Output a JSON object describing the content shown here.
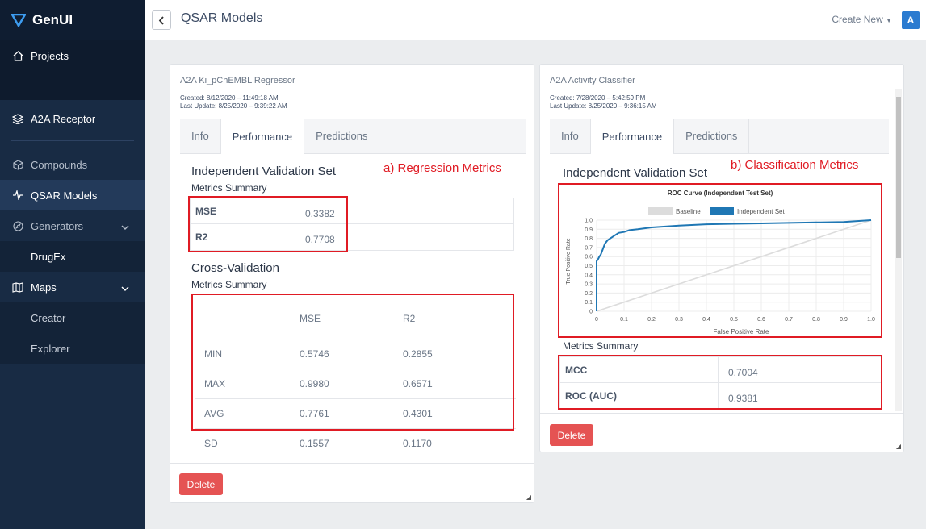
{
  "sidebar": {
    "brand": "GenUI",
    "projects": "Projects",
    "project_name": "A2A Receptor",
    "compounds": "Compounds",
    "qsar_models": "QSAR Models",
    "generators": "Generators",
    "drugex": "DrugEx",
    "maps": "Maps",
    "creator": "Creator",
    "explorer": "Explorer"
  },
  "header": {
    "title": "QSAR Models",
    "create_new": "Create New",
    "avatar_letter": "A"
  },
  "colors": {
    "accent": "#2b7bd0",
    "danger": "#e55353",
    "annotation": "#e01b24",
    "sidebar": "#182b44"
  },
  "regressor": {
    "title": "A2A Ki_pChEMBL Regressor",
    "created": "Created: 8/12/2020 – 11:49:18 AM",
    "updated": "Last Update: 8/25/2020 – 9:39:22 AM",
    "tabs": [
      "Info",
      "Performance",
      "Predictions"
    ],
    "annotation": "a) Regression Metrics",
    "validation_title": "Independent Validation Set",
    "metrics_summary": "Metrics Summary",
    "validation": [
      {
        "key": "MSE",
        "value": "0.3382"
      },
      {
        "key": "R2",
        "value": "0.7708"
      }
    ],
    "cv_title": "Cross-Validation",
    "cv_summary": "Metrics Summary",
    "cv_headers": [
      "",
      "MSE",
      "R2"
    ],
    "cv_rows": [
      [
        "MIN",
        "0.5746",
        "0.2855"
      ],
      [
        "MAX",
        "0.9980",
        "0.6571"
      ],
      [
        "AVG",
        "0.7761",
        "0.4301"
      ],
      [
        "SD",
        "0.1557",
        "0.1170"
      ]
    ],
    "delete": "Delete"
  },
  "classifier": {
    "title": "A2A Activity Classifier",
    "created": "Created: 7/28/2020 – 5:42:59 PM",
    "updated": "Last Update: 8/25/2020 – 9:36:15 AM",
    "tabs": [
      "Info",
      "Performance",
      "Predictions"
    ],
    "annotation": "b) Classification Metrics",
    "validation_title": "Independent Validation Set",
    "metrics_summary": "Metrics Summary",
    "metrics": [
      {
        "key": "MCC",
        "value": "0.7004"
      },
      {
        "key": "ROC (AUC)",
        "value": "0.9381"
      }
    ],
    "delete": "Delete"
  },
  "chart_data": {
    "type": "line",
    "title": "ROC Curve (Independent Test Set)",
    "xlabel": "False Positive Rate",
    "ylabel": "True Positive Rate",
    "xlim": [
      0,
      1
    ],
    "ylim": [
      0,
      1
    ],
    "xticks": [
      "0",
      "0.1",
      "0.2",
      "0.3",
      "0.4",
      "0.5",
      "0.6",
      "0.7",
      "0.8",
      "0.9",
      "1.0"
    ],
    "yticks": [
      "0",
      "0.1",
      "0.2",
      "0.3",
      "0.4",
      "0.5",
      "0.6",
      "0.7",
      "0.8",
      "0.9",
      "1.0"
    ],
    "grid": true,
    "legend": "top",
    "series": [
      {
        "name": "Baseline",
        "color": "#dcdcdc",
        "x": [
          0,
          1
        ],
        "y": [
          0,
          1
        ]
      },
      {
        "name": "Independent Set",
        "color": "#1f77b4",
        "x": [
          0,
          0,
          0.005,
          0.01,
          0.015,
          0.02,
          0.025,
          0.03,
          0.035,
          0.04,
          0.05,
          0.06,
          0.07,
          0.08,
          0.1,
          0.12,
          0.15,
          0.2,
          0.25,
          0.3,
          0.4,
          0.5,
          0.6,
          0.7,
          0.8,
          0.9,
          1.0
        ],
        "y": [
          0,
          0.55,
          0.57,
          0.6,
          0.62,
          0.66,
          0.7,
          0.74,
          0.76,
          0.78,
          0.8,
          0.82,
          0.84,
          0.86,
          0.87,
          0.89,
          0.9,
          0.92,
          0.93,
          0.94,
          0.955,
          0.96,
          0.965,
          0.97,
          0.975,
          0.98,
          1.0
        ]
      }
    ]
  }
}
